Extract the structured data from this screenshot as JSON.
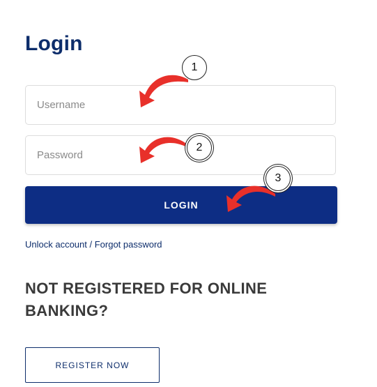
{
  "login": {
    "title": "Login",
    "username_placeholder": "Username",
    "password_placeholder": "Password",
    "login_button": "LOGIN",
    "forgot_link": "Unlock account / Forgot password"
  },
  "registration": {
    "heading": "NOT REGISTERED FOR ONLINE BANKING?",
    "register_button": "REGISTER NOW"
  },
  "annotations": {
    "steps": [
      "1",
      "2",
      "3"
    ],
    "arrow_color": "#e8302a"
  },
  "colors": {
    "brand_navy": "#0d2d84",
    "heading_text": "#3a3a3a"
  }
}
